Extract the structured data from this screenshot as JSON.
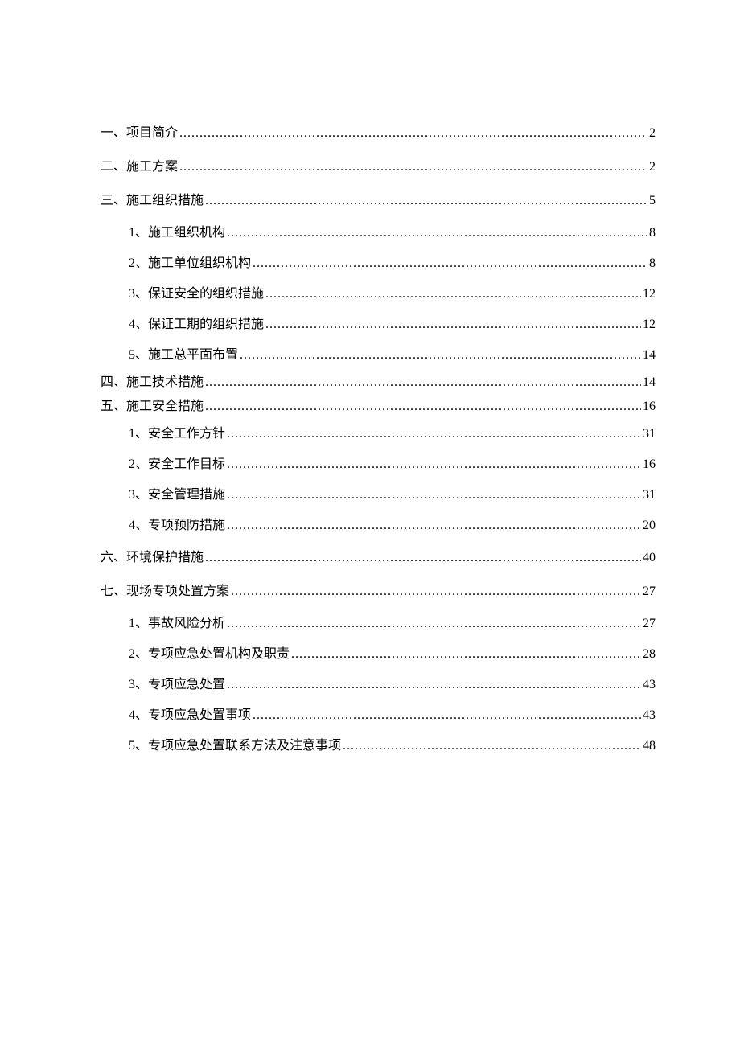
{
  "toc": [
    {
      "level": 1,
      "label": "一、项目简介",
      "page": "2",
      "tight": false
    },
    {
      "level": 1,
      "label": "二、施工方案",
      "page": "2",
      "tight": false
    },
    {
      "level": 1,
      "label": "三、施工组织措施",
      "page": "5",
      "tight": false
    },
    {
      "level": 2,
      "label": "1、施工组织机构",
      "page": "8",
      "tight": false
    },
    {
      "level": 2,
      "label": "2、施工单位组织机构",
      "page": "8",
      "tight": false
    },
    {
      "level": 2,
      "label": "3、保证安全的组织措施",
      "page": "12",
      "tight": false
    },
    {
      "level": 2,
      "label": "4、保证工期的组织措施",
      "page": "12",
      "tight": false
    },
    {
      "level": 2,
      "label": "5、施工总平面布置",
      "page": "14",
      "tight": false
    },
    {
      "level": 1,
      "label": "四、施工技术措施",
      "page": "14",
      "tight": true
    },
    {
      "level": 1,
      "label": "五、施工安全措施",
      "page": "16",
      "tight": true
    },
    {
      "level": 2,
      "label": "1、安全工作方针",
      "page": "31",
      "tight": false
    },
    {
      "level": 2,
      "label": "2、安全工作目标",
      "page": "16",
      "tight": false
    },
    {
      "level": 2,
      "label": "3、安全管理措施",
      "page": "31",
      "tight": false
    },
    {
      "level": 2,
      "label": "4、专项预防措施",
      "page": "20",
      "tight": false
    },
    {
      "level": 1,
      "label": "六、环境保护措施",
      "page": "40",
      "tight": false
    },
    {
      "level": 1,
      "label": "七、现场专项处置方案",
      "page": "27",
      "tight": false
    },
    {
      "level": 2,
      "label": "1、事故风险分析",
      "page": "27",
      "tight": false
    },
    {
      "level": 2,
      "label": "2、专项应急处置机构及职责",
      "page": "28",
      "tight": false
    },
    {
      "level": 2,
      "label": "3、专项应急处置",
      "page": "43",
      "tight": false
    },
    {
      "level": 2,
      "label": "4、专项应急处置事项",
      "page": "43",
      "tight": false
    },
    {
      "level": 2,
      "label": "5、专项应急处置联系方法及注意事项",
      "page": "48",
      "tight": false
    }
  ]
}
